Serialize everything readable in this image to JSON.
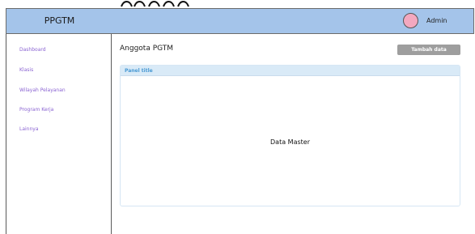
{
  "app": {
    "brand": "PPGTM"
  },
  "header": {
    "user_name": "Admin"
  },
  "sidebar": {
    "items": [
      {
        "label": "Dashboard"
      },
      {
        "label": "Klasis"
      },
      {
        "label": "Wilayah Pelayanan"
      },
      {
        "label": "Program Kerja"
      },
      {
        "label": "Lainnya"
      }
    ]
  },
  "main": {
    "title": "Anggota PGTM",
    "add_button_label": "Tambah data",
    "panel": {
      "title": "Panel title",
      "body_text": "Data Master"
    }
  },
  "colors": {
    "header_bg": "#a4c4ea",
    "sidebar_link": "#8a63d2",
    "avatar": "#f3a8bf",
    "button_bg": "#9e9e9e",
    "panel_header_bg": "#d9eaf7",
    "panel_title": "#4a9ad4"
  }
}
